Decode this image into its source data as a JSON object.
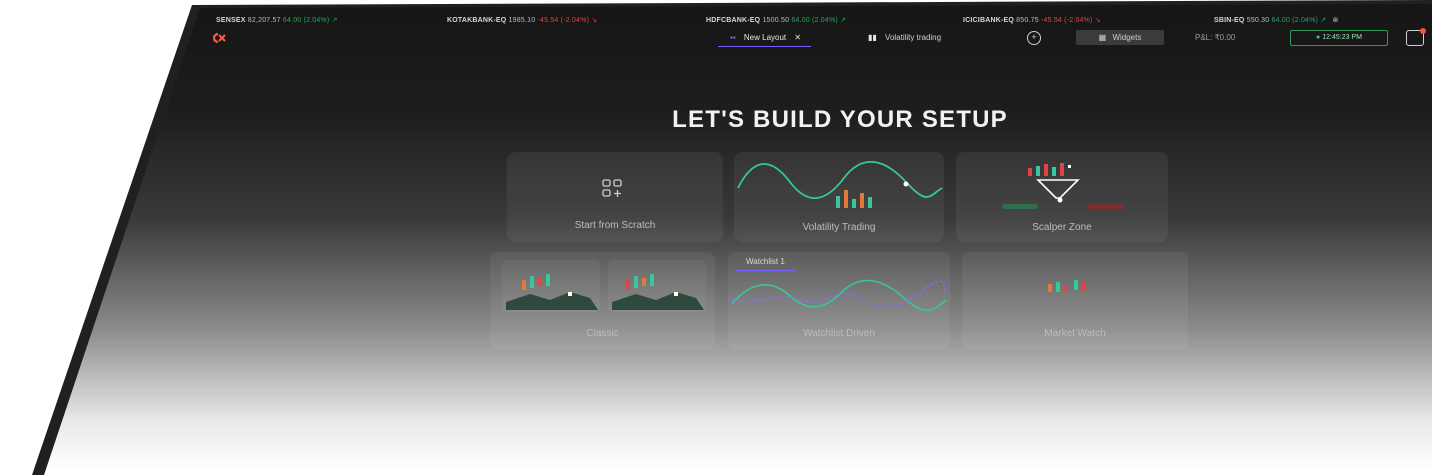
{
  "ticker": [
    {
      "name": "SENSEX",
      "price": "82,207.57",
      "change": "64.00 (2.04%)",
      "dir": "up"
    },
    {
      "name": "KOTAKBANK-EQ",
      "price": "1985.10",
      "change": "-45.54 (-2.04%)",
      "dir": "down"
    },
    {
      "name": "HDFCBANK-EQ",
      "price": "1500.50",
      "change": "64.00 (2.04%)",
      "dir": "up"
    },
    {
      "name": "ICICIBANK-EQ",
      "price": "850.75",
      "change": "-45.54 (-2.04%)",
      "dir": "down"
    },
    {
      "name": "SBIN-EQ",
      "price": "550.30",
      "change": "64.00 (2.04%)",
      "dir": "up"
    }
  ],
  "topbar": {
    "layout_tab": "New Layout",
    "close": "✕",
    "volatility_tab": "Volatility trading",
    "widgets": "Widgets",
    "pnl": "P&L: ₹0.00",
    "time": "12:45:23 PM"
  },
  "main": {
    "title": "LET'S BUILD YOUR SETUP",
    "cards": [
      {
        "label": "Start from Scratch"
      },
      {
        "label": "Volatility Trading"
      },
      {
        "label": "Scalper Zone"
      },
      {
        "label": "Classic"
      },
      {
        "label": "Watchlist Driven",
        "tag": "Watchlist 1"
      },
      {
        "label": "Market Watch"
      }
    ]
  },
  "colors": {
    "up": "#26a65b",
    "down": "#e04545",
    "accent": "#7b5cff",
    "teal": "#37c79a"
  }
}
